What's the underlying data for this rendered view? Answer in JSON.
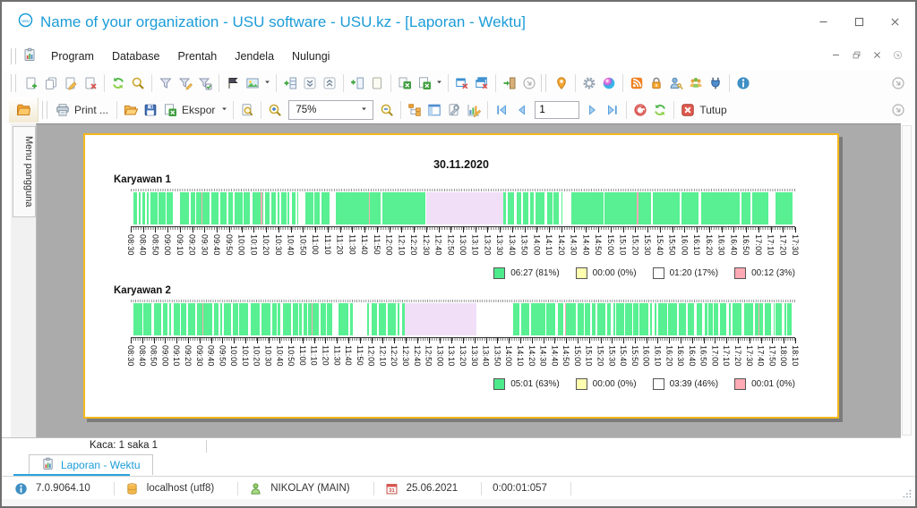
{
  "window": {
    "title": "Name of your organization - USU software - USU.kz - [Laporan - Wektu]"
  },
  "menu": {
    "items": [
      "Program",
      "Database",
      "Prentah",
      "Jendela",
      "Nulungi"
    ]
  },
  "toolbar_main": {
    "icons": [
      "add-record",
      "duplicate",
      "edit",
      "delete",
      "refresh",
      "search",
      "filter",
      "filter-edit",
      "filter-checked",
      "flag",
      "image",
      "insert-column",
      "collapse-all",
      "expand-all",
      "add-column",
      "note",
      "excel-copy",
      "excel-export",
      "close-window",
      "close-all-windows",
      "exit",
      "overflow",
      "location",
      "settings",
      "theme",
      "rss",
      "lock",
      "user-rights",
      "users",
      "plugin",
      "about"
    ]
  },
  "toolbar_report": {
    "print_label": "Print ...",
    "export_label": "Ekspor",
    "zoom_value": "75%",
    "page_value": "1",
    "close_label": "Tutup",
    "icons": [
      "user-menu-folder",
      "print",
      "open",
      "save",
      "export",
      "preview",
      "zoom-in",
      "zoom-select",
      "zoom-out",
      "structure",
      "parameters",
      "edit-page",
      "design",
      "first-page",
      "prev-page",
      "page-number",
      "next-page",
      "last-page",
      "stop",
      "refresh",
      "close"
    ]
  },
  "sidebar": {
    "vertical_tab": "Menu pangguna"
  },
  "report": {
    "date_title": "30.11.2020",
    "page_status": "Kaca: 1 saka 1",
    "tab_label": "Laporan - Wektu"
  },
  "chart_data": [
    {
      "type": "timeline-barcode",
      "title": "Karyawan 1",
      "date": "30.11.2020",
      "axis": {
        "start": "08:30",
        "end": "17:30",
        "step_minutes": 10
      },
      "colors": {
        "work": "#58f092",
        "pause": "#f1dff8",
        "gap": "#ffffff",
        "violation": "#ffaab4"
      },
      "legend": [
        {
          "color": "#4dea8c",
          "label": "06:27 (81%)"
        },
        {
          "color": "#ffffb0",
          "label": "00:00 (0%)"
        },
        {
          "color": "#ffffff",
          "label": "01:20 (17%)"
        },
        {
          "color": "#ffaab4",
          "label": "00:12 (3%)"
        }
      ],
      "segments": [
        {
          "from": "08:32",
          "to": "09:04",
          "kind": "dense",
          "pink": 0.22
        },
        {
          "from": "09:04",
          "to": "09:10",
          "kind": "gap"
        },
        {
          "from": "09:10",
          "to": "10:14",
          "kind": "dense",
          "pink": 0.1
        },
        {
          "from": "10:14",
          "to": "10:32",
          "kind": "dense",
          "pink": 0.5
        },
        {
          "from": "10:32",
          "to": "10:46",
          "kind": "dense",
          "pink": 0.05
        },
        {
          "from": "10:46",
          "to": "10:52",
          "kind": "gap"
        },
        {
          "from": "10:52",
          "to": "11:13",
          "kind": "dense",
          "pink": 0.05
        },
        {
          "from": "11:13",
          "to": "11:17",
          "kind": "gap"
        },
        {
          "from": "11:17",
          "to": "12:30",
          "kind": "solid",
          "pink": 0.12
        },
        {
          "from": "12:30",
          "to": "13:33",
          "kind": "lavender"
        },
        {
          "from": "13:33",
          "to": "14:21",
          "kind": "dense",
          "pink": 0.08
        },
        {
          "from": "14:21",
          "to": "14:28",
          "kind": "gap"
        },
        {
          "from": "14:28",
          "to": "17:08",
          "kind": "solid",
          "pink": 0.05
        },
        {
          "from": "17:08",
          "to": "17:14",
          "kind": "gap"
        },
        {
          "from": "17:14",
          "to": "17:28",
          "kind": "solid",
          "pink": 0
        }
      ]
    },
    {
      "type": "timeline-barcode",
      "title": "Karyawan 2",
      "date": "30.11.2020",
      "axis": {
        "start": "08:30",
        "end": "18:10",
        "step_minutes": 10
      },
      "colors": {
        "work": "#58f092",
        "pause": "#f1dff8",
        "gap": "#ffffff",
        "violation": "#ffaab4"
      },
      "legend": [
        {
          "color": "#4dea8c",
          "label": "05:01 (63%)"
        },
        {
          "color": "#ffffb0",
          "label": "00:00 (0%)"
        },
        {
          "color": "#ffffff",
          "label": "03:39 (46%)"
        },
        {
          "color": "#ffaab4",
          "label": "00:01 (0%)"
        }
      ],
      "segments": [
        {
          "from": "08:32",
          "to": "11:08",
          "kind": "dense",
          "pink": 0.01
        },
        {
          "from": "11:08",
          "to": "11:09",
          "kind": "pink"
        },
        {
          "from": "11:09",
          "to": "11:26",
          "kind": "dense",
          "pink": 0
        },
        {
          "from": "11:26",
          "to": "11:31",
          "kind": "gap"
        },
        {
          "from": "11:31",
          "to": "11:44",
          "kind": "solid",
          "pink": 0
        },
        {
          "from": "11:44",
          "to": "11:56",
          "kind": "gap"
        },
        {
          "from": "11:56",
          "to": "12:29",
          "kind": "dense",
          "pink": 0
        },
        {
          "from": "12:29",
          "to": "13:32",
          "kind": "lavender"
        },
        {
          "from": "13:32",
          "to": "14:04",
          "kind": "gap"
        },
        {
          "from": "14:04",
          "to": "14:49",
          "kind": "dense",
          "pink": 0
        },
        {
          "from": "14:49",
          "to": "14:50",
          "kind": "pink"
        },
        {
          "from": "14:50",
          "to": "17:38",
          "kind": "dense",
          "pink": 0
        },
        {
          "from": "17:38",
          "to": "17:39",
          "kind": "pink"
        },
        {
          "from": "17:39",
          "to": "18:08",
          "kind": "dense",
          "pink": 0
        }
      ]
    }
  ],
  "statusbar": {
    "version": "7.0.9064.10",
    "database": "localhost (utf8)",
    "user": "NIKOLAY (MAIN)",
    "date": "25.06.2021",
    "timer": "0:00:01:057"
  },
  "colors": {
    "accent_blue": "#1b9cd8",
    "page_border": "#f5b81a",
    "preview_bg": "#ababab",
    "work_green": "#58f092",
    "pause_lavender": "#f1dff8",
    "violation_pink": "#ffaab4",
    "legend_yellow": "#ffffb0"
  }
}
